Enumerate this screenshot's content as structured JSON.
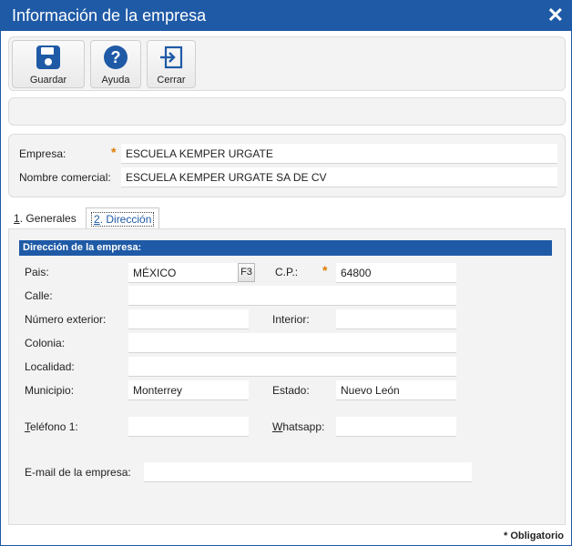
{
  "window": {
    "title": "Información de la empresa",
    "close_glyph": "✕"
  },
  "toolbar": {
    "save_label": "Guardar",
    "help_label": "Ayuda",
    "close_label": "Cerrar"
  },
  "company": {
    "empresa_label": "Empresa:",
    "empresa_value": "ESCUELA KEMPER URGATE",
    "nombre_comercial_label": "Nombre comercial:",
    "nombre_comercial_value": "ESCUELA KEMPER URGATE SA DE CV"
  },
  "tabs": [
    {
      "mnemonic": "1",
      "rest": ". Generales"
    },
    {
      "mnemonic": "2",
      "rest": ". Dirección"
    }
  ],
  "address": {
    "section_title": "Dirección de la empresa:",
    "pais_label": "Pais:",
    "pais_value": "MÉXICO",
    "f3_label": "F3",
    "cp_label": "C.P.:",
    "cp_value": "64800",
    "calle_label": "Calle:",
    "calle_value": "",
    "numero_exterior_label": "Número exterior:",
    "numero_exterior_value": "",
    "interior_label": "Interior:",
    "interior_value": "",
    "colonia_label": "Colonia:",
    "colonia_value": "",
    "localidad_label": "Localidad:",
    "localidad_value": "",
    "municipio_label": "Municipio:",
    "municipio_value": "Monterrey",
    "estado_label": "Estado:",
    "estado_value": "Nuevo León",
    "telefono_label_first": "T",
    "telefono_label_rest": "eléfono 1:",
    "telefono_value": "",
    "whatsapp_label_first": "W",
    "whatsapp_label_rest": "hatsapp:",
    "whatsapp_value": "",
    "email_label": "E-mail de la empresa:",
    "email_value": ""
  },
  "footer": {
    "required_note": "* Obligatorio"
  },
  "required_star": "*",
  "colors": {
    "accent": "#1f5aa6",
    "required": "#e07b00",
    "panel_bg": "#f3f3f3"
  }
}
